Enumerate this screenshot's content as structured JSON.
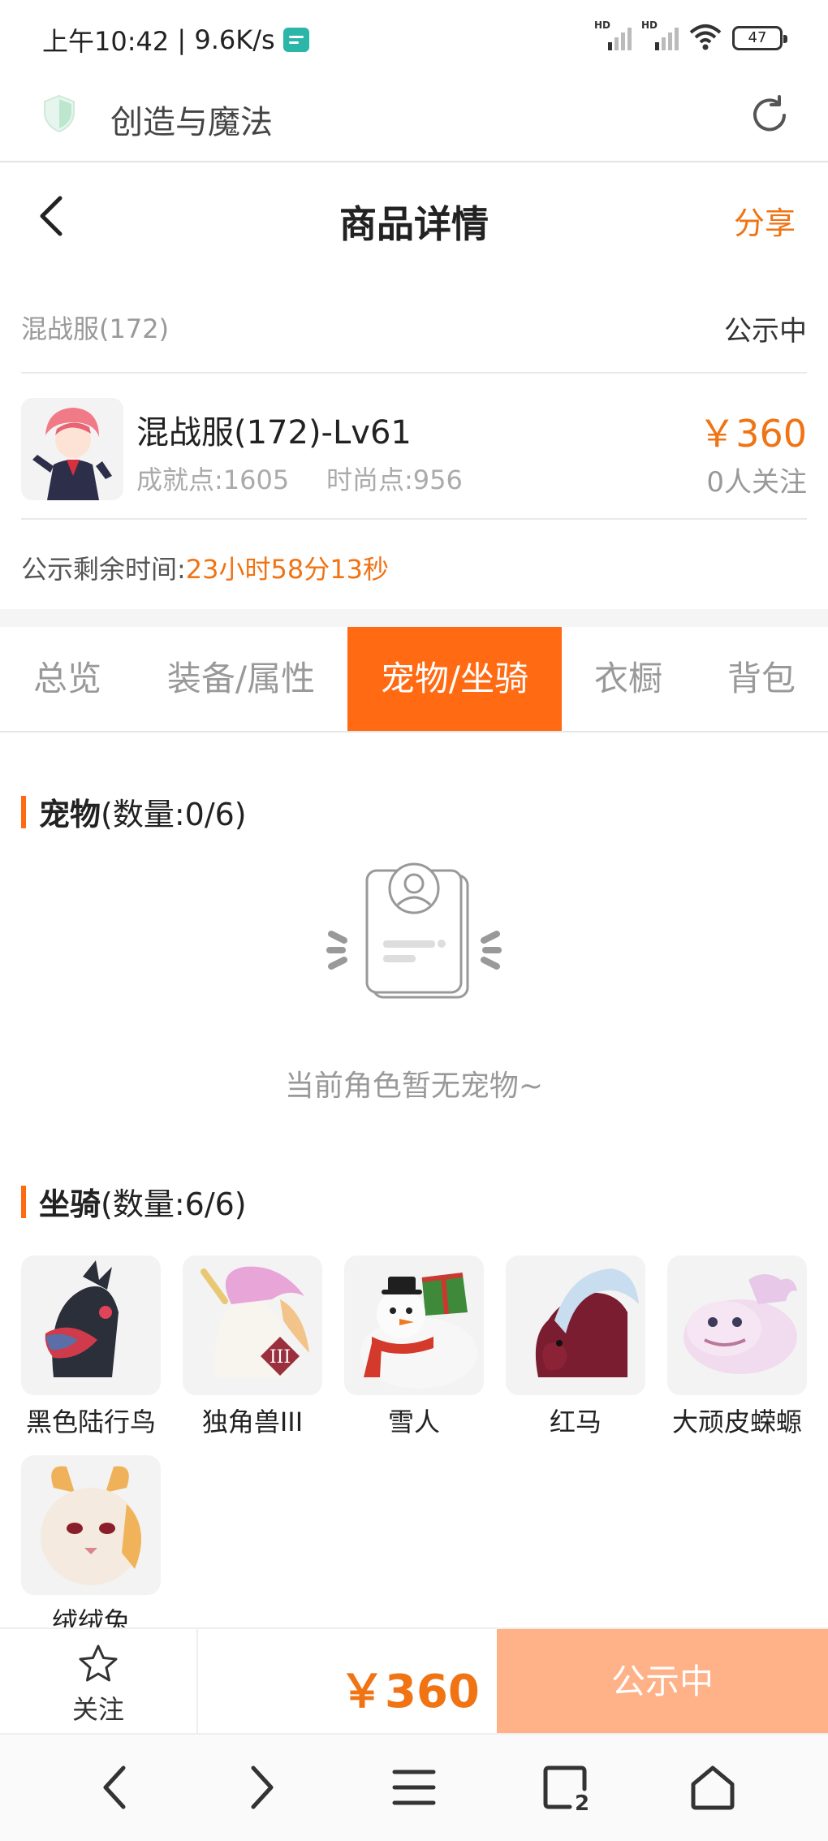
{
  "status_bar": {
    "time": "上午10:42",
    "speed": "9.6K/s",
    "sim1": "HD",
    "sim2": "HD",
    "battery": "47"
  },
  "browser": {
    "site_title": "创造与魔法"
  },
  "header": {
    "title": "商品详情",
    "share_label": "分享"
  },
  "server": {
    "name": "混战服(172)",
    "status": "公示中"
  },
  "product": {
    "name": "混战服(172)-Lv61",
    "achievement": "成就点:1605",
    "fashion": "时尚点:956",
    "price": "￥360",
    "followers": "0人关注"
  },
  "countdown": {
    "label": "公示剩余时间:",
    "time": "23小时58分13秒"
  },
  "tabs": [
    "总览",
    "装备/属性",
    "宠物/坐骑",
    "衣橱",
    "背包"
  ],
  "active_tab": "宠物/坐骑",
  "pets": {
    "title": "宠物",
    "count": "(数量:0/6)",
    "empty_text": "当前角色暂无宠物~"
  },
  "mounts": {
    "title": "坐骑",
    "count": "(数量:6/6)",
    "items": [
      "黑色陆行鸟",
      "独角兽III",
      "雪人",
      "红马",
      "大顽皮蝾螈",
      "绒绒兔"
    ]
  },
  "action_bar": {
    "follow_label": "关注",
    "price": "￥360",
    "status_button": "公示中"
  },
  "colors": {
    "accent": "#ff6a13",
    "price": "#f07314",
    "disabled_button": "#ffb187"
  }
}
